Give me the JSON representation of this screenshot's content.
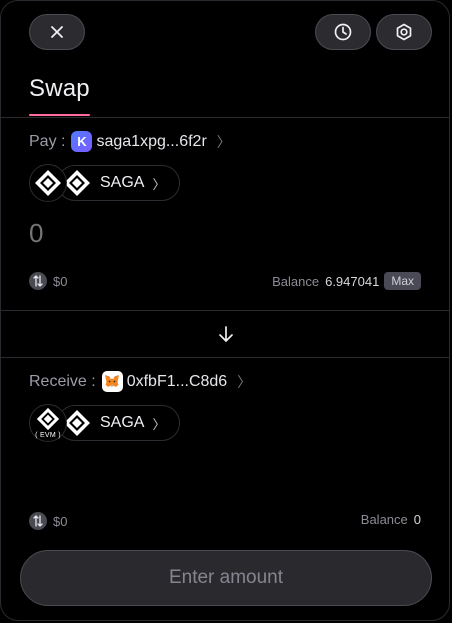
{
  "header": {
    "tab_label": "Swap"
  },
  "pay": {
    "label": "Pay :",
    "wallet_icon": "keplr-icon",
    "address": "saga1xpg...6f2r",
    "chain_icon": "saga-chain-icon",
    "token_symbol": "SAGA",
    "amount_placeholder": "0",
    "usd_value": "$0",
    "balance_label": "Balance",
    "balance_value": "6.947041",
    "max_label": "Max"
  },
  "receive": {
    "label": "Receive :",
    "wallet_icon": "metamask-icon",
    "address": "0xfbF1...C8d6",
    "chain_icon": "saga-evm-chain-icon",
    "chain_tag": "( EVM )",
    "token_symbol": "SAGA",
    "usd_value": "$0",
    "balance_label": "Balance",
    "balance_value": "0"
  },
  "cta": {
    "label": "Enter amount"
  },
  "colors": {
    "accent": "#ff6b9e",
    "background": "#000000",
    "button": "#2c2c30"
  }
}
